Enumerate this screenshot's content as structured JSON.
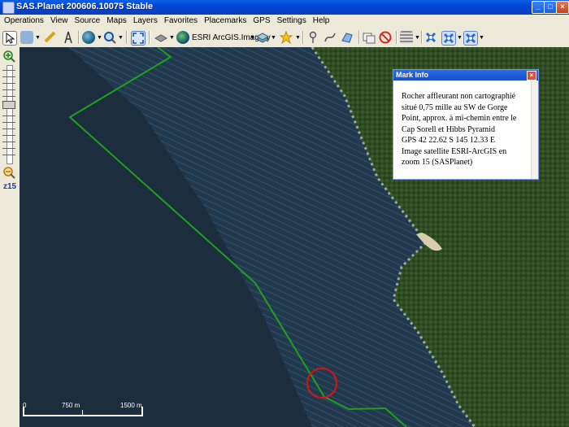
{
  "window": {
    "title": "SAS.Planet 200606.10075 Stable"
  },
  "menu": [
    "Operations",
    "View",
    "Source",
    "Maps",
    "Layers",
    "Favorites",
    "Placemarks",
    "GPS",
    "Settings",
    "Help"
  ],
  "toolbar": {
    "map_source_label": "ESRI ArcGIS.Imagery"
  },
  "zoom": {
    "level_label": "z15"
  },
  "scale": {
    "labels": [
      "0",
      "750 m",
      "1500 m"
    ]
  },
  "mark_info": {
    "title": "Mark Info",
    "lines": [
      "Rocher affleurant non cartographié",
      "situé 0,75 mille au SW de Gorge",
      "Point, approx. à mi-chemin entre le",
      "Cap Sorell et Hibbs Pyramid",
      "GPS 42 22.62 S 145 12.33 E",
      "Image satellite ESRI-ArcGIS en",
      "zoom 15 (SASPlanet)"
    ]
  },
  "colors": {
    "boundary": "#1fa01f",
    "marker": "#e01010",
    "titlebar": "#0a5fe6"
  }
}
